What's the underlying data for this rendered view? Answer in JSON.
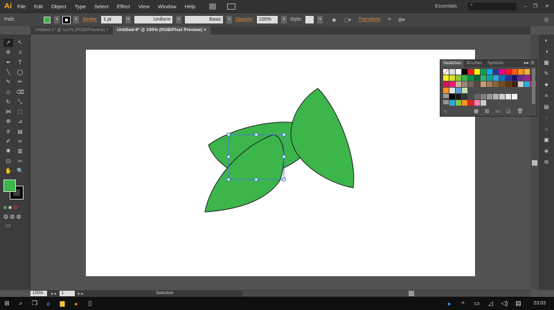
{
  "app": {
    "logo": "Ai",
    "menus": [
      "File",
      "Edit",
      "Object",
      "Type",
      "Select",
      "Effect",
      "View",
      "Window",
      "Help"
    ],
    "workspace": "Essentials",
    "search_placeholder": ""
  },
  "control": {
    "selection_type": "Path",
    "stroke_label": "Stroke:",
    "stroke_weight": "1 pt",
    "profile": "Uniform",
    "brush": "Basic",
    "opacity_label": "Opacity:",
    "opacity": "100%",
    "style_label": "Style:",
    "transform_label": "Transform",
    "fill_color": "#3cb54a"
  },
  "tabs": [
    {
      "label": "Untitled-1* @ 111% (RGB/Preview)",
      "close": "×"
    },
    {
      "label": "Untitled-9* @ 100% (RGB/Pixel Preview)",
      "close": "×"
    }
  ],
  "swatches": {
    "tabs": [
      "Swatches",
      "Brushes",
      "Symbols"
    ],
    "rows": [
      [
        "#ffffff",
        "#000000",
        "#ed1c24",
        "#fff200",
        "#00a651",
        "#00aeef",
        "#2e3192",
        "#ec008c",
        "#ed1c24",
        "#f15a24",
        "#f7931e",
        "#fbb03b"
      ],
      [
        "#fcee21",
        "#d9e021",
        "#8cc63f",
        "#39b54a",
        "#009245",
        "#006837",
        "#22b573",
        "#00a99d",
        "#29abe2",
        "#0071bc",
        "#2e3192",
        "#1b1464",
        "#662d91",
        "#93278f",
        "#9e005d"
      ],
      [
        "#d4145a",
        "#ed1e79",
        "#c7b299",
        "#998675",
        "#736357",
        "#534741",
        "#c69c6d",
        "#a67c52",
        "#8c6239",
        "#754c24",
        "#603813",
        "#42210b",
        "#cccccc",
        "#29abe2",
        "#ed1e79"
      ],
      [
        "#f7931e",
        "#e6e6e6",
        "#5b9bd5",
        "#c7e0b4"
      ],
      [
        "#000000",
        "#1a1a1a",
        "#333333",
        "#4d4d4d",
        "#666666",
        "#808080",
        "#999999",
        "#b3b3b3",
        "#cccccc",
        "#e6e6e6",
        "#f2f2f2"
      ],
      [
        "#29abe2",
        "#8cc63f",
        "#f7931e",
        "#ed1c24",
        "#ff7bac",
        "#cccccc"
      ]
    ]
  },
  "status": {
    "zoom": "100%",
    "page": "1",
    "tool": "Selection"
  },
  "taskbar": {
    "time": "23:03"
  }
}
